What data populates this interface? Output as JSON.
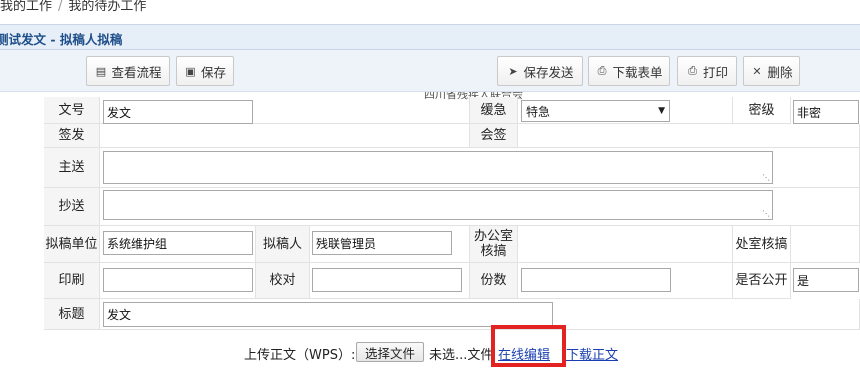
{
  "breadcrumb": {
    "item1": "我的工作",
    "separator": "/",
    "item2": "我的待办工作"
  },
  "title": "测试发文 - 拟稿人拟稿",
  "toolbar": {
    "view_flow": "查看流程",
    "save": "保存",
    "save_send": "保存发送",
    "download_form": "下载表单",
    "print": "打印",
    "delete": "删除"
  },
  "form": {
    "caption": "四川省残疾人联合会",
    "labels": {
      "doc_no": "文号",
      "urgency": "缓急",
      "secret_level": "密级",
      "sign": "签发",
      "countersign": "会签",
      "main_send": "主送",
      "copy_send": "抄送",
      "draft_unit": "拟稿单位",
      "drafter": "拟稿人",
      "office_review": "办公室核搞",
      "dept_review": "处室核搞",
      "printing": "印刷",
      "proofread": "校对",
      "copies": "份数",
      "is_public": "是否公开",
      "subject": "标题"
    },
    "values": {
      "doc_no": "发文",
      "urgency": "特急",
      "secret_level": "非密",
      "main_send": "",
      "copy_send": "",
      "draft_unit": "系统维护组",
      "drafter": "残联管理员",
      "printing": "",
      "proofread": "",
      "copies": "",
      "is_public": "是",
      "subject": "发文"
    }
  },
  "upload": {
    "label": "上传正文（WPS）:",
    "choose_file": "选择文件",
    "no_file": "未选...文件",
    "online_edit": "在线编辑",
    "download_text": "下载正文"
  },
  "colors": {
    "title_text": "#1f4f8a",
    "title_bg": "#e6eef8",
    "highlight": "#e32222",
    "link": "#1a3fb0"
  }
}
